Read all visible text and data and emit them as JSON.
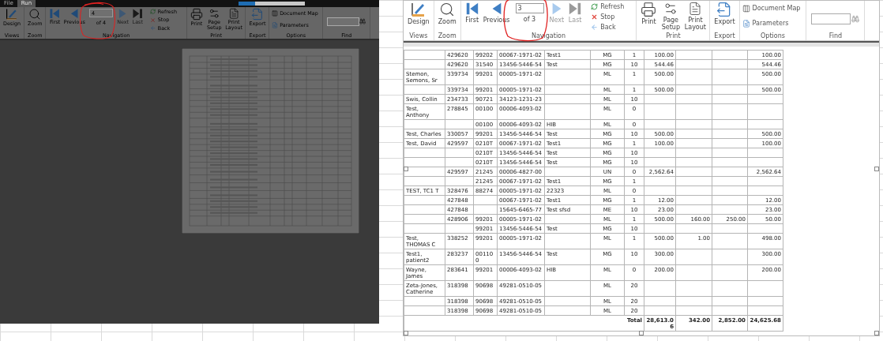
{
  "viewers": [
    {
      "dimmed": true,
      "menu_tabs": [
        {
          "label": "File",
          "selected": false
        },
        {
          "label": "Run",
          "selected": true
        }
      ],
      "ribbon": {
        "views": {
          "label": "Views",
          "design": "Design"
        },
        "zoom": {
          "label": "Zoom",
          "zoom": "Zoom"
        },
        "navigation": {
          "label": "Navigation",
          "first": {
            "label": "First",
            "disabled": false
          },
          "previous": {
            "label": "Previous",
            "disabled": false
          },
          "page": "4",
          "page_count": "of 4",
          "next": {
            "label": "Next",
            "disabled": true
          },
          "last": {
            "label": "Last",
            "disabled": true
          },
          "refresh": "Refresh",
          "stop": "Stop",
          "back": "Back"
        },
        "print": {
          "label": "Print",
          "print": "Print",
          "page_setup": "Page Setup",
          "print_layout": "Print Layout"
        },
        "export": {
          "label": "Export",
          "export": "Export"
        },
        "options": {
          "label": "Options",
          "document_map": "Document Map",
          "parameters": "Parameters"
        },
        "find": {
          "label": "Find"
        }
      },
      "report": {
        "kind": "thumbnail"
      }
    },
    {
      "dimmed": false,
      "ribbon": {
        "views": {
          "label": "Views",
          "design": "Design"
        },
        "zoom": {
          "label": "Zoom",
          "zoom": "Zoom"
        },
        "navigation": {
          "label": "Navigation",
          "first": {
            "label": "First",
            "disabled": false
          },
          "previous": {
            "label": "Previous",
            "disabled": false
          },
          "page": "3",
          "page_count": "of 3",
          "next": {
            "label": "Next",
            "disabled": true
          },
          "last": {
            "label": "Last",
            "disabled": true
          },
          "refresh": "Refresh",
          "stop": "Stop",
          "back": "Back"
        },
        "print": {
          "label": "Print",
          "print": "Print",
          "page_setup": "Page Setup",
          "print_layout": "Print Layout"
        },
        "export": {
          "label": "Export",
          "export": "Export"
        },
        "options": {
          "label": "Options",
          "document_map": "Document Map",
          "parameters": "Parameters"
        },
        "find": {
          "label": "Find"
        }
      },
      "report": {
        "kind": "table",
        "rows": [
          [
            null,
            "429620",
            "99202",
            "00067-1971-02",
            "Test1",
            "MG",
            "1",
            "100.00",
            null,
            null,
            "100.00"
          ],
          [
            null,
            "429620",
            "31540",
            "13456-5446-54",
            "Test",
            "MG",
            "10",
            "544.46",
            null,
            null,
            "544.46"
          ],
          [
            "Stemon, Semons, Sr",
            "339734",
            "99201",
            "00005-1971-02",
            null,
            "ML",
            "1",
            "500.00",
            null,
            null,
            "500.00"
          ],
          [
            null,
            "339734",
            "99201",
            "00005-1971-02",
            null,
            "ML",
            "1",
            "500.00",
            null,
            null,
            "500.00"
          ],
          [
            "Swis, Collin",
            "234733",
            "90721",
            "34123-1231-23",
            null,
            "ML",
            "10",
            null,
            null,
            null,
            null
          ],
          [
            "Test, Anthony",
            "278845",
            "00100",
            "00006-4093-02",
            null,
            "ML",
            "0",
            null,
            null,
            null,
            null
          ],
          [
            null,
            null,
            "00100",
            "00006-4093-02",
            "HIB",
            "ML",
            "0",
            null,
            null,
            null,
            null
          ],
          [
            "Test, Charles",
            "330057",
            "99201",
            "13456-5446-54",
            "Test",
            "MG",
            "10",
            "500.00",
            null,
            null,
            "500.00"
          ],
          [
            "Test, David",
            "429597",
            "0210T",
            "00067-1971-02",
            "Test1",
            "MG",
            "1",
            "100.00",
            null,
            null,
            "100.00"
          ],
          [
            null,
            null,
            "0210T",
            "13456-5446-54",
            "Test",
            "MG",
            "10",
            null,
            null,
            null,
            null
          ],
          [
            null,
            null,
            "0210T",
            "13456-5446-54",
            "Test",
            "MG",
            "10",
            null,
            null,
            null,
            null
          ],
          [
            null,
            "429597",
            "21245",
            "00006-4827-00",
            null,
            "UN",
            "0",
            "2,562.64",
            null,
            null,
            "2,562.64"
          ],
          [
            null,
            null,
            "21245",
            "00067-1971-02",
            "Test1",
            "MG",
            "1",
            null,
            null,
            null,
            null
          ],
          [
            "TEST, TC1 T",
            "328476",
            "88274",
            "00005-1971-02",
            "22323",
            "ML",
            "0",
            null,
            null,
            null,
            null
          ],
          [
            null,
            "427848",
            null,
            "00067-1971-02",
            "Test1",
            "MG",
            "1",
            "12.00",
            null,
            null,
            "12.00"
          ],
          [
            null,
            "427848",
            null,
            "15645-6465-77",
            "Test sfsd",
            "ME",
            "10",
            "23.00",
            null,
            null,
            "23.00"
          ],
          [
            null,
            "428906",
            "99201",
            "00005-1971-02",
            null,
            "ML",
            "1",
            "500.00",
            "160.00",
            "250.00",
            "50.00"
          ],
          [
            null,
            null,
            "99201",
            "13456-5446-54",
            "Test",
            "MG",
            "10",
            null,
            null,
            null,
            null
          ],
          [
            "Test, THOMAS C",
            "338252",
            "99201",
            "00005-1971-02",
            null,
            "ML",
            "1",
            "500.00",
            "1.00",
            null,
            "498.00"
          ],
          [
            "Test1, patient2",
            "283237",
            "001100",
            "13456-5446-54",
            "Test",
            "MG",
            "10",
            "300.00",
            null,
            null,
            "300.00"
          ],
          [
            "Wayne, James",
            "283641",
            "99201",
            "00006-4093-02",
            "HIB",
            "ML",
            "0",
            "200.00",
            null,
            null,
            "200.00"
          ],
          [
            "Zeta-Jones, Catherine",
            "318398",
            "90698",
            "49281-0510-05",
            null,
            "ML",
            "20",
            null,
            null,
            null,
            null
          ],
          [
            null,
            "318398",
            "90698",
            "49281-0510-05",
            null,
            "ML",
            "20",
            null,
            null,
            null,
            null
          ],
          [
            null,
            "318398",
            "90698",
            "49281-0510-05",
            null,
            "ML",
            "20",
            null,
            null,
            null,
            null
          ]
        ],
        "total": {
          "label": "Total",
          "values": [
            "28,613.06",
            "342.00",
            "2,852.00",
            "24,625.68"
          ]
        }
      }
    }
  ]
}
